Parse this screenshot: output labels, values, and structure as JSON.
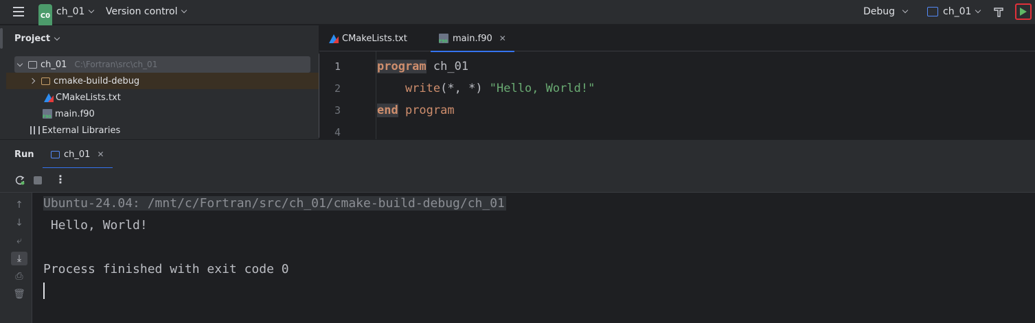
{
  "titlebar": {
    "project_badge": "C0",
    "project_name": "ch_01",
    "vcs_label": "Version control",
    "config_label": "Debug",
    "target_label": "ch_01"
  },
  "project_panel": {
    "title": "Project",
    "tree": {
      "root_name": "ch_01",
      "root_path": "C:\\Fortran\\src\\ch_01",
      "items": [
        {
          "label": "cmake-build-debug",
          "icon": "folder-icon"
        },
        {
          "label": "CMakeLists.txt",
          "icon": "cmake-icon"
        },
        {
          "label": "main.f90",
          "icon": "fortran-file-icon"
        }
      ],
      "external": "External Libraries"
    }
  },
  "editor": {
    "tabs": [
      {
        "label": "CMakeLists.txt",
        "icon": "cmake-icon"
      },
      {
        "label": "main.f90",
        "icon": "fortran-file-icon",
        "active": true
      }
    ],
    "line_numbers": [
      "1",
      "2",
      "3",
      "4"
    ],
    "code": {
      "l1_kw": "program",
      "l1_rest": " ch_01",
      "l2_indent": "    ",
      "l2_fn": "write",
      "l2_args": "(*, *) ",
      "l2_str": "\"Hello, World!\"",
      "l3_kw": "end",
      "l3_rest": " program"
    }
  },
  "run_panel": {
    "title": "Run",
    "tab_label": "ch_01",
    "console": {
      "command": "Ubuntu-24.04: /mnt/c/Fortran/src/ch_01/cmake-build-debug/ch_01",
      "output": " Hello, World!",
      "finished": "Process finished with exit code 0"
    }
  },
  "colors": {
    "accent": "#3574f0",
    "run_button_border": "#e0313a",
    "keyword": "#cf8e6d",
    "string": "#6aab73"
  }
}
